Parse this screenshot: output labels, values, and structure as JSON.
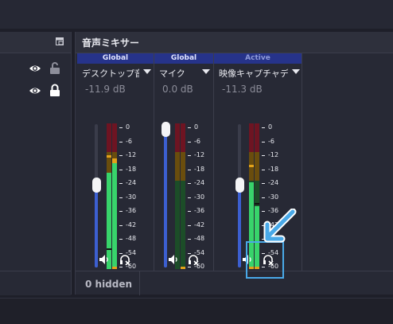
{
  "mixer": {
    "title": "音声ミキサー",
    "hidden_count": "0 hidden",
    "channels": [
      {
        "mode": "Global",
        "name": "デスクトップ音声",
        "db": "-11.9 dB",
        "volume_fraction": 0.58
      },
      {
        "mode": "Global",
        "name": "マイク",
        "db": "0.0 dB",
        "volume_fraction": 1.0
      },
      {
        "mode": "Active",
        "name": "映像キャプチャデバイ",
        "db": "-11.3 dB",
        "volume_fraction": 0.58
      }
    ],
    "scale": [
      "0",
      "-6",
      "-12",
      "-18",
      "-24",
      "-30",
      "-36",
      "-42",
      "-48",
      "-54",
      "-60"
    ]
  },
  "sources": {
    "rows": [
      {
        "visibility_icon": "eye-icon",
        "lock_icon": "unlocked-icon"
      },
      {
        "visibility_icon": "eye-icon",
        "lock_icon": "locked-icon"
      }
    ]
  },
  "colors": {
    "accent": "#49a9e8",
    "fader_blue": "#3c5fd0",
    "meter_green": "#38d46b",
    "meter_yellow": "#e3a21a",
    "meter_red": "#c9213a"
  }
}
